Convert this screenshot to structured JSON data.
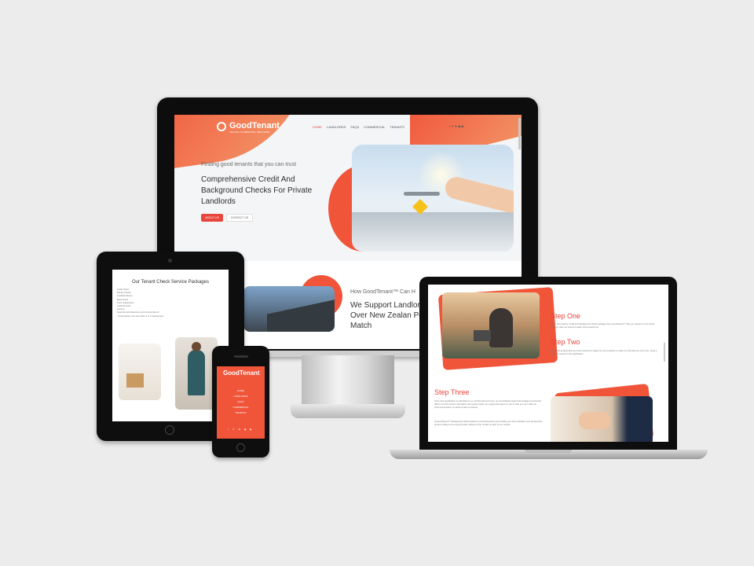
{
  "brand": {
    "name": "GoodTenant",
    "tagline_small": "TENANT SCREENING SERVICES",
    "accent": "#e8453c",
    "gradient_start": "#f0553a",
    "gradient_end": "#f39a6a"
  },
  "desktop": {
    "nav": [
      "HOME",
      "LANDLORDS",
      "FAQS",
      "COMMERCIAL",
      "TENANTS"
    ],
    "social_icons": [
      "facebook-icon",
      "twitter-icon",
      "pinterest-icon",
      "instagram-icon",
      "youtube-icon"
    ],
    "social_glyphs": "f ✦ ⊕ ◉ ▶",
    "hero": {
      "tagline": "Finding good tenants that you can trust",
      "title": "Comprehensive Credit And Background Checks For Private Landlords",
      "btn_primary": "ABOUT US",
      "btn_secondary": "CONTACT US"
    },
    "section2": {
      "kicker": "How GoodTenant™ Can H",
      "title": "We Support Landlord All Over New Zealan Perfect Match"
    }
  },
  "tablet": {
    "title": "Our Tenant Check Service Packages",
    "list": [
      "Credit Check",
      "Identity Checks",
      "Landlord Review",
      "Bank Check",
      "Court Judgements",
      "Credit Records",
      "Tenancy",
      "Searches with Reference and Criminal Record",
      "* All the above to be sent within 2 to 3 working days"
    ]
  },
  "phone": {
    "logo": "GoodTenant",
    "nav": [
      "HOME",
      "LANDLORDS",
      "FAQS",
      "COMMERCIAL",
      "TENANTS"
    ],
    "social_glyphs": "f ✦ ⊕ ◉ ▶"
  },
  "laptop": {
    "step_one": {
      "title": "Step One",
      "text": "Order the tenancy credit and background check package from GoodTenant™ that you require for the rental property that you intend to place new tenants into."
    },
    "step_two": {
      "title": "Step Two",
      "text": "Direct the tenants that you have selected to apply for your property to click on a link that we send you, using a code for access to the application."
    },
    "step_three": {
      "title": "Step Three",
      "text1": "Once their application is submitted to us via this link and code, we immediately begin their background checks. When we have all the information and reports back, we supply that report to you so that you can make an informed decision on which tenant to choose.",
      "text2": "A GoodTenant™ background check delivers a comprehensive report telling you know whether your prospective tenant is likely to be a good tenant, based on the results of each of our checks."
    }
  }
}
